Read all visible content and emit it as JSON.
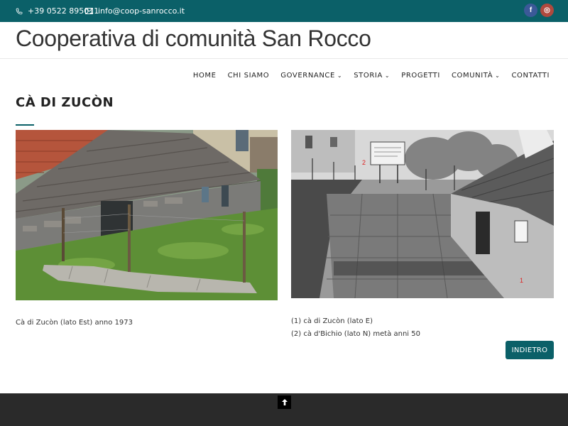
{
  "topbar": {
    "phone": "+39 0522 895011",
    "email": "info@coop-sanrocco.it",
    "social": [
      {
        "icon": "facebook-icon",
        "glyph": "f"
      },
      {
        "icon": "instagram-icon",
        "glyph": "◎"
      }
    ]
  },
  "site": {
    "title": "Cooperativa di comunità San Rocco"
  },
  "nav": {
    "items": [
      {
        "label": "HOME",
        "has_dropdown": false
      },
      {
        "label": "CHI SIAMO",
        "has_dropdown": false
      },
      {
        "label": "GOVERNANCE",
        "has_dropdown": true
      },
      {
        "label": "STORIA",
        "has_dropdown": true
      },
      {
        "label": "PROGETTI",
        "has_dropdown": false
      },
      {
        "label": "COMUNITÀ",
        "has_dropdown": true
      },
      {
        "label": "CONTATTI",
        "has_dropdown": false
      }
    ]
  },
  "page": {
    "heading": "CÀ DI ZUCÒN",
    "left_caption": "Cà di Zucòn (lato Est) anno 1973",
    "right_caption_1": "(1) cà di Zucòn (lato E)",
    "right_caption_2": "(2) cà d'Bichio (lato N) metà anni 50",
    "back_label": "INDIETRO",
    "photo_markers": [
      "2",
      "1"
    ]
  },
  "colors": {
    "accent": "#0b6068",
    "footer": "#2a2a2a"
  }
}
